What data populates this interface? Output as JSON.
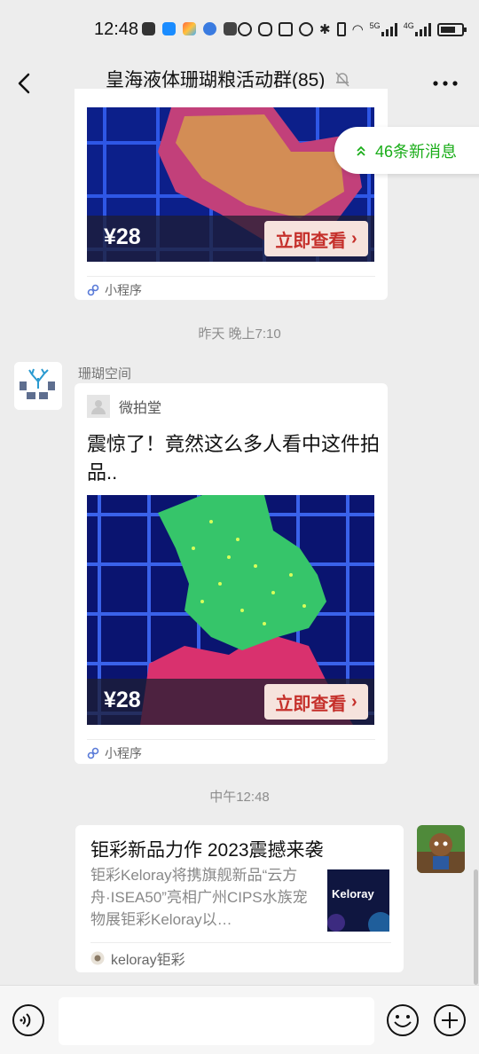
{
  "status_bar": {
    "time": "12:48",
    "network_5g": "5G",
    "network_4g": "4G"
  },
  "header": {
    "title": "皇海液体珊瑚粮活动群(85)",
    "icons": [
      "back-arrow-icon",
      "mute-bell-icon",
      "more-dots-icon"
    ]
  },
  "new_messages": {
    "label": "46条新消息"
  },
  "messages": [
    {
      "type": "mini_program_partial",
      "price": "¥28",
      "cta": "立即查看",
      "footer": "小程序"
    },
    {
      "type": "timestamp",
      "text": "昨天 晚上7:10"
    },
    {
      "type": "mini_program",
      "sender": "珊瑚空间",
      "source": "微拍堂",
      "title": "震惊了！竟然这么多人看中这件拍品..",
      "price": "¥28",
      "cta": "立即查看",
      "footer": "小程序"
    },
    {
      "type": "timestamp",
      "text": "中午12:48"
    },
    {
      "type": "link",
      "title": "钜彩新品力作 2023震撼来袭",
      "description": "钜彩Keloray将携旗舰新品“云方舟·ISEA50”亮相广州CIPS水族宠物展钜彩Keloray以…",
      "thumb_text": "Keloray",
      "source": "keloray钜彩"
    }
  ],
  "colors": {
    "background": "#ededed",
    "accent_green": "#1aad19",
    "cta_red": "#c5302b"
  }
}
